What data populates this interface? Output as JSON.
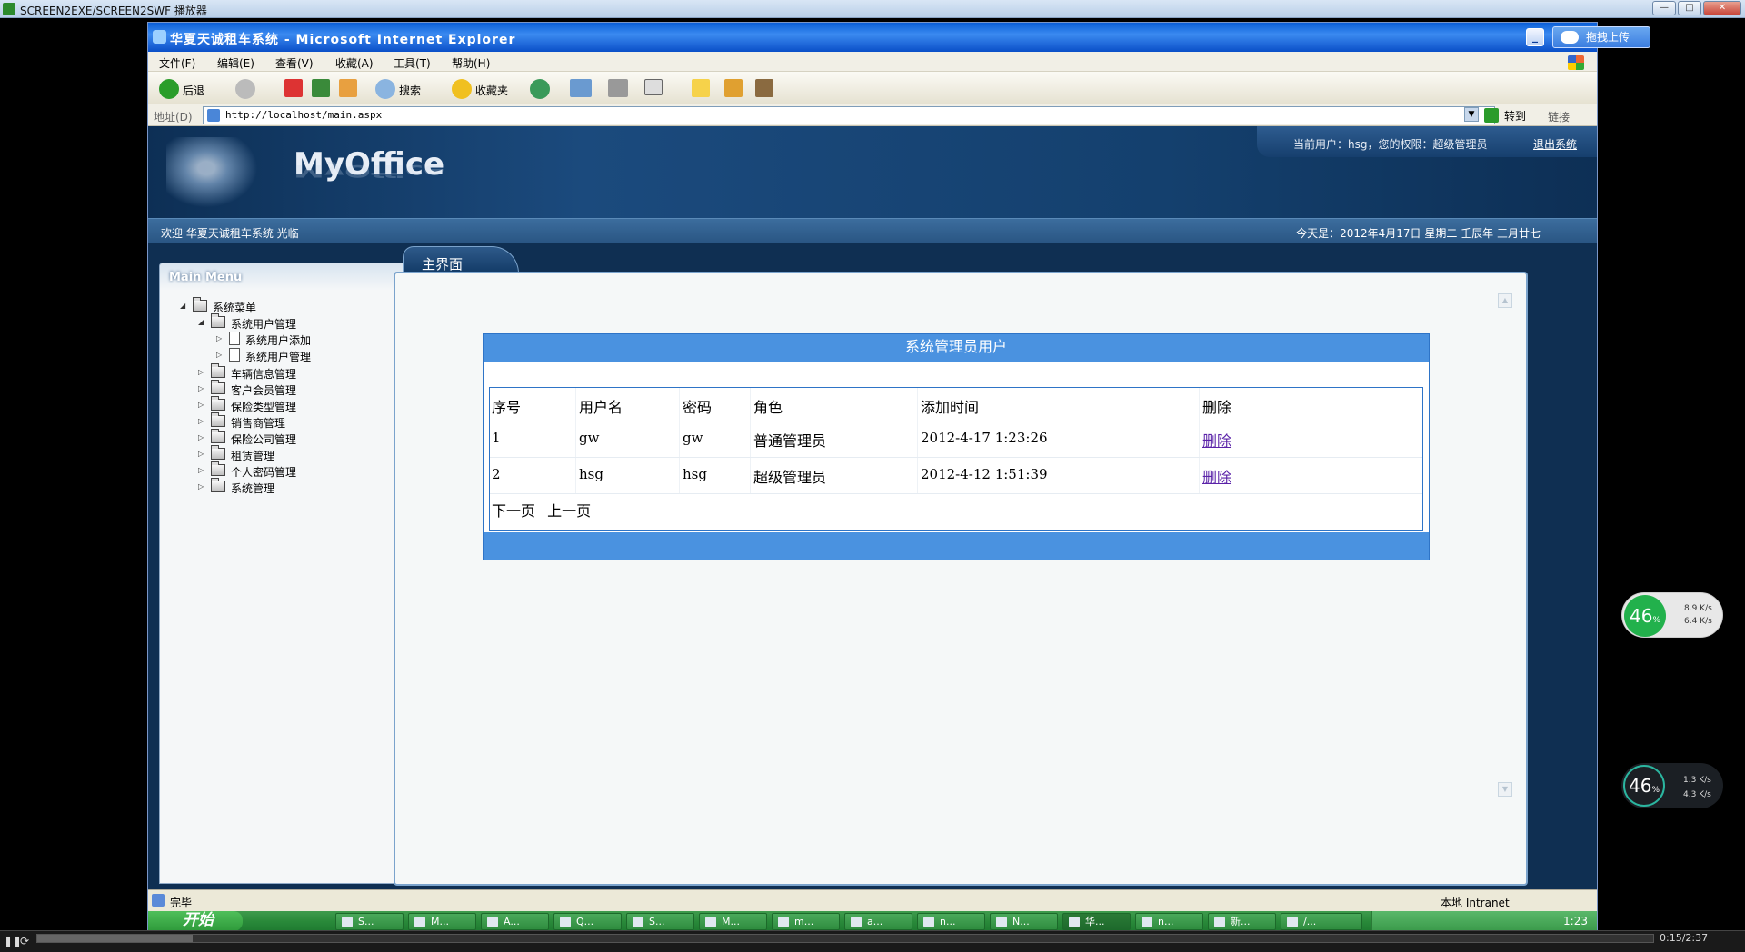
{
  "player": {
    "title": "SCREEN2EXE/SCREEN2SWF 播放器",
    "time": "0:15/2:37",
    "progress": 0.096
  },
  "ie": {
    "title": "华夏天诚租车系统 - Microsoft Internet Explorer",
    "upload_label": "拖拽上传",
    "menu": [
      "文件(F)",
      "编辑(E)",
      "查看(V)",
      "收藏(A)",
      "工具(T)",
      "帮助(H)"
    ],
    "toolbar": {
      "back": "后退",
      "search": "搜索",
      "favorites": "收藏夹"
    },
    "address_label": "地址(D)",
    "address_value": "http://localhost/main.aspx",
    "go_label": "转到",
    "links_label": "链接",
    "status_done": "完毕",
    "status_zone": "本地 Intranet"
  },
  "page": {
    "logo": "MyOffice",
    "current_user": "当前用户：hsg，您的权限：超级管理员",
    "logout": "退出系统",
    "welcome": "欢迎 华夏天诚租车系统 光临",
    "date": "今天是：2012年4月17日 星期二 壬辰年 三月廿七",
    "menu_title": "Main Menu",
    "tree": {
      "root": "系统菜单",
      "user_mgmt": "系统用户管理",
      "user_add": "系统用户添加",
      "user_manage": "系统用户管理",
      "vehicle": "车辆信息管理",
      "customer": "客户会员管理",
      "insurance_type": "保险类型管理",
      "dealer": "销售商管理",
      "insurance_co": "保险公司管理",
      "lease": "租赁管理",
      "password": "个人密码管理",
      "system": "系统管理"
    },
    "tab": "主界面",
    "grid": {
      "title": "系统管理员用户",
      "headers": [
        "序号",
        "用户名",
        "密码",
        "角色",
        "添加时间",
        "删除"
      ],
      "rows": [
        [
          "1",
          "gw",
          "gw",
          "普通管理员",
          "2012-4-17 1:23:26",
          "删除"
        ],
        [
          "2",
          "hsg",
          "hsg",
          "超级管理员",
          "2012-4-12 1:51:39",
          "删除"
        ]
      ],
      "next": "下一页",
      "prev": "上一页"
    }
  },
  "taskbar": {
    "start": "开始",
    "tasks": [
      "S...",
      "M...",
      "A...",
      "Q...",
      "S...",
      "M...",
      "m...",
      "a...",
      "n...",
      "N...",
      "华...",
      "n...",
      "新...",
      "/..."
    ],
    "clock": "1:23"
  },
  "net_widgets": [
    {
      "pct": "46",
      "up": "8.9 K/s",
      "dn": "6.4 K/s"
    },
    {
      "pct": "46",
      "up": "1.3 K/s",
      "dn": "4.3 K/s"
    }
  ]
}
